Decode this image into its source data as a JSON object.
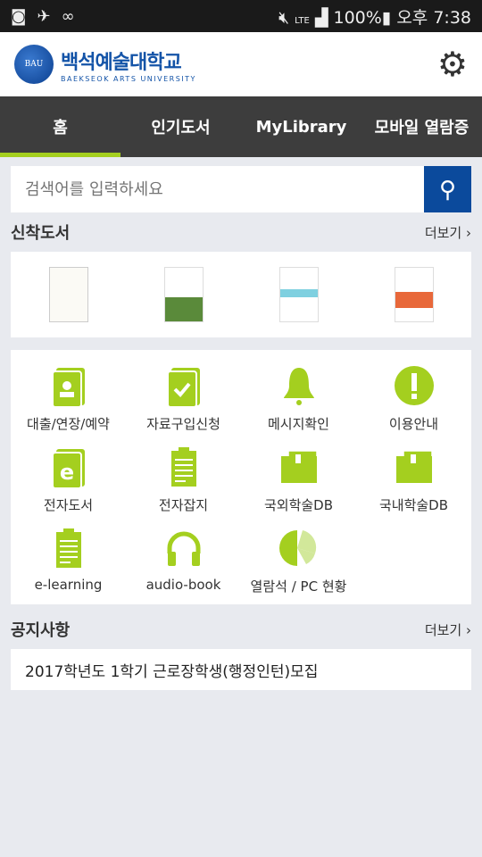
{
  "status": {
    "time": "오후 7:38",
    "battery": "100%",
    "network": "LTE"
  },
  "header": {
    "logo_ko": "백석예술대학교",
    "logo_en": "BAEKSEOK ARTS UNIVERSITY",
    "emblem": "BAU"
  },
  "nav": {
    "tabs": [
      {
        "label": "홈"
      },
      {
        "label": "인기도서"
      },
      {
        "label": "MyLibrary"
      },
      {
        "label": "모바일 열람증"
      }
    ]
  },
  "search": {
    "placeholder": "검색어를 입력하세요"
  },
  "new_books": {
    "title": "신착도서",
    "more": "더보기 ›"
  },
  "menu": [
    {
      "label": "대출/연장/예약",
      "icon": "book-user"
    },
    {
      "label": "자료구입신청",
      "icon": "book-check"
    },
    {
      "label": "메시지확인",
      "icon": "bell"
    },
    {
      "label": "이용안내",
      "icon": "exclamation"
    },
    {
      "label": "전자도서",
      "icon": "ebook"
    },
    {
      "label": "전자잡지",
      "icon": "clipboard"
    },
    {
      "label": "국외학술DB",
      "icon": "wallet"
    },
    {
      "label": "국내학술DB",
      "icon": "wallet"
    },
    {
      "label": "e-learning",
      "icon": "clipboard"
    },
    {
      "label": "audio-book",
      "icon": "headphones"
    },
    {
      "label": "열람석 / PC 현황",
      "icon": "pie-chart"
    }
  ],
  "notice": {
    "title": "공지사항",
    "more": "더보기 ›",
    "items": [
      "2017학년도 1학기 근로장학생(행정인턴)모집"
    ]
  },
  "colors": {
    "accent": "#a4cf1f",
    "nav": "#3d3d3d",
    "search_button": "#0b4a9c"
  }
}
